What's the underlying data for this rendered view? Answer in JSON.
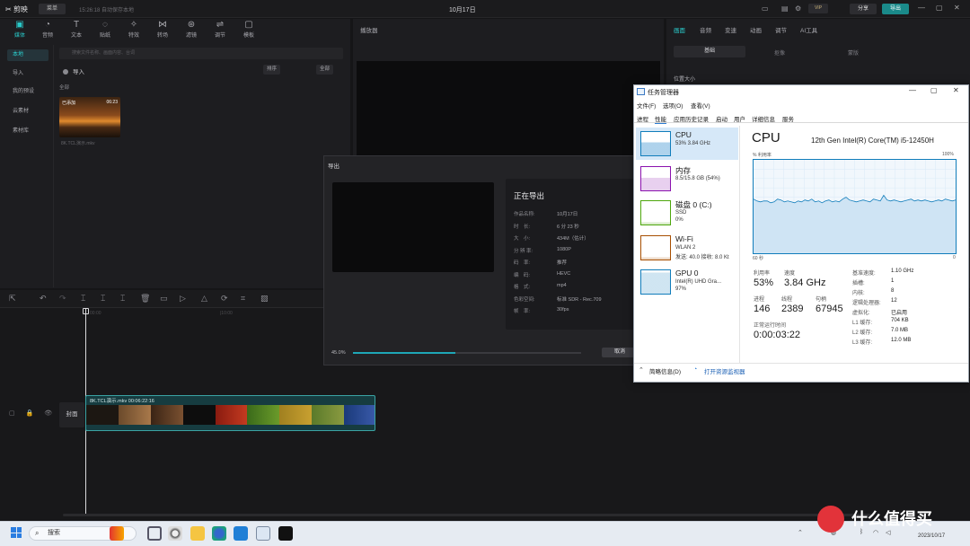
{
  "editor": {
    "logo": "✂ 剪映",
    "menu": "菜单",
    "autosave": "15:26:18 自动保存本地",
    "project_title": "10月17日",
    "vip": "VIP",
    "share": "分享",
    "export": "导出",
    "media_tabs": [
      "媒体",
      "音频",
      "文本",
      "贴纸",
      "特效",
      "转场",
      "滤镜",
      "调节",
      "模板"
    ],
    "side_nav": [
      "本地",
      "导入",
      "我的预设",
      "云素材",
      "素材库"
    ],
    "search_placeholder": "搜索文件名称、画面内容、台词",
    "import_label": "导入",
    "sort_buttons": [
      "排序",
      "全部"
    ],
    "all_label": "全部",
    "thumb_badge": "已添加",
    "thumb_duration": "06:23",
    "thumb_name": "8K.TCL演示.mkv",
    "player_title": "播放器",
    "prop_tabs": [
      "画面",
      "音频",
      "变速",
      "动画",
      "调节",
      "AI工具"
    ],
    "prop_subtabs": [
      "基础",
      "抠像",
      "蒙版"
    ],
    "position_label": "位置大小",
    "ruler_marks": [
      "00:00",
      "|10:00"
    ],
    "clip_label": "8K.TCL演示.mkv  00:06:22:16",
    "cover_label": "封面"
  },
  "export_dialog": {
    "title": "导出",
    "status": "正在导出",
    "rows": [
      {
        "k": "作品名称:",
        "v": "10月17日"
      },
      {
        "k": "时　长:",
        "v": "6 分 23 秒"
      },
      {
        "k": "大　小:",
        "v": "434M（估计）"
      },
      {
        "k": "分 辨 率:",
        "v": "1080P"
      },
      {
        "k": "码　率:",
        "v": "推荐"
      },
      {
        "k": "编　码:",
        "v": "HEVC"
      },
      {
        "k": "格　式:",
        "v": "mp4"
      },
      {
        "k": "色彩空间:",
        "v": "标准 SDR - Rec.709"
      },
      {
        "k": "帧　率:",
        "v": "30fps"
      }
    ],
    "progress_text": "45.0%",
    "progress": 0.45,
    "cancel": "取消"
  },
  "task_manager": {
    "title": "任务管理器",
    "menu": [
      "文件(F)",
      "选项(O)",
      "查看(V)"
    ],
    "tabs": [
      "进程",
      "性能",
      "应用历史记录",
      "启动",
      "用户",
      "详细信息",
      "服务"
    ],
    "active_tab": "性能",
    "resources": [
      {
        "name": "CPU",
        "l1": "53%  3.84 GHz",
        "l2": "",
        "color": "#117dbb"
      },
      {
        "name": "内存",
        "l1": "8.5/15.8 GB (54%)",
        "l2": "",
        "color": "#8b12ae"
      },
      {
        "name": "磁盘 0 (C:)",
        "l1": "SSD",
        "l2": "0%",
        "color": "#4da60c"
      },
      {
        "name": "Wi-Fi",
        "l1": "WLAN 2",
        "l2": "发送: 40.0  接收: 8.0 Kt",
        "color": "#a74f01"
      },
      {
        "name": "GPU 0",
        "l1": "Intel(R) UHD Gra...",
        "l2": "97%",
        "color": "#117dbb"
      }
    ],
    "header": "CPU",
    "model": "12th Gen Intel(R) Core(TM) i5-12450H",
    "util_label": "% 利用率",
    "util_max": "100%",
    "time_label": "60 秒",
    "time_end": "0",
    "stats": {
      "utilization_label": "利用率",
      "utilization": "53%",
      "speed_label": "速度",
      "speed": "3.84 GHz",
      "processes_label": "进程",
      "processes": "146",
      "threads_label": "线程",
      "threads": "2389",
      "handles_label": "句柄",
      "handles": "67945",
      "uptime_label": "正常运行时间",
      "uptime": "0:00:03:22"
    },
    "specs": [
      {
        "k": "基准速度:",
        "v": "1.10 GHz"
      },
      {
        "k": "插槽:",
        "v": "1"
      },
      {
        "k": "内核:",
        "v": "8"
      },
      {
        "k": "逻辑处理器:",
        "v": "12"
      },
      {
        "k": "虚拟化:",
        "v": "已启用"
      },
      {
        "k": "L1 缓存:",
        "v": "704 KB"
      },
      {
        "k": "L2 缓存:",
        "v": "7.0 MB"
      },
      {
        "k": "L3 缓存:",
        "v": "12.0 MB"
      }
    ],
    "cpu_history": [
      58,
      56,
      55,
      56,
      56,
      54,
      55,
      58,
      57,
      55,
      56,
      55,
      54,
      56,
      55,
      57,
      56,
      58,
      55,
      56,
      54,
      56,
      57,
      55,
      56,
      55,
      58,
      60,
      57,
      56,
      55,
      56,
      57,
      56,
      55,
      58,
      57,
      56,
      62,
      57,
      56,
      57,
      56,
      55,
      56,
      57,
      58,
      56,
      57,
      56,
      57,
      56,
      55,
      56,
      57,
      56,
      58,
      57,
      56,
      57
    ],
    "footer_less": "简略信息(D)",
    "footer_monitor": "打开资源监视器"
  },
  "taskbar": {
    "search": "搜索",
    "date": "2023/10/17"
  },
  "watermark": "什么值得买"
}
